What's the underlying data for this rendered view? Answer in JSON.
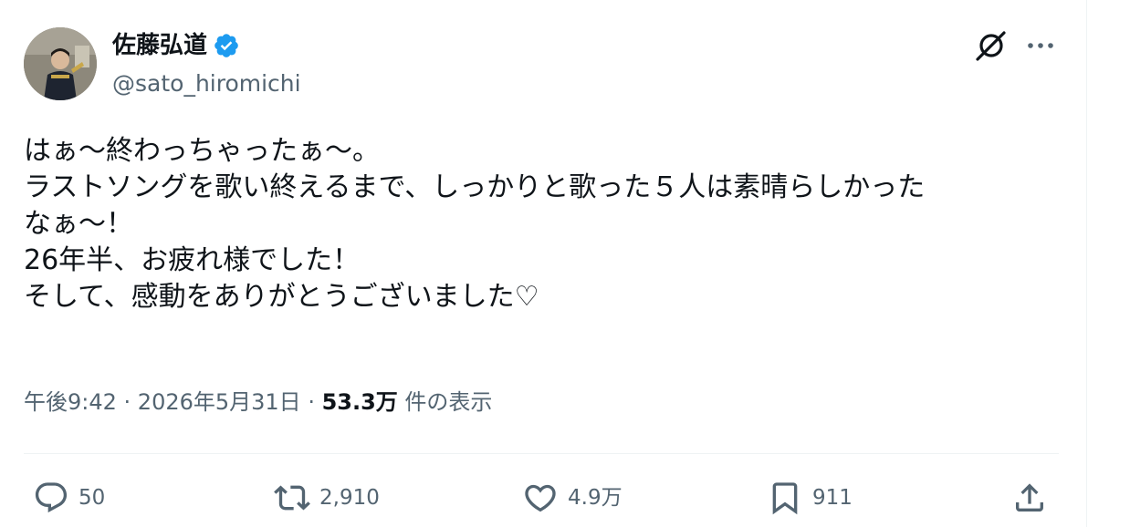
{
  "author": {
    "display_name": "佐藤弘道",
    "handle": "@sato_hiromichi",
    "verified": true,
    "verified_color": "#1d9bf0"
  },
  "body": {
    "lines": [
      "はぁ～終わっちゃったぁ～。",
      "ラストソングを歌い終えるまで、しっかりと歌った５人は素晴らしかった",
      "なぁ～！",
      "26年半、お疲れ様でした！",
      "そして、感動をありがとうございました♡"
    ]
  },
  "meta": {
    "time": "午後9:42",
    "separator1": " · ",
    "date": "2026年5月31日",
    "separator2": " · ",
    "views_count": "53.3万",
    "views_label": " 件の表示"
  },
  "actions": {
    "reply": {
      "icon": "reply-icon",
      "count": "50"
    },
    "retweet": {
      "icon": "retweet-icon",
      "count": "2,910"
    },
    "like": {
      "icon": "heart-icon",
      "count": "4.9万"
    },
    "bookmark": {
      "icon": "bookmark-icon",
      "count": "911"
    },
    "share": {
      "icon": "share-icon"
    }
  },
  "header_icons": {
    "grok": "grok-icon",
    "more": "more-icon"
  },
  "colors": {
    "text_primary": "#0f1419",
    "text_secondary": "#536471",
    "divider": "#eff3f4",
    "accent": "#1d9bf0"
  }
}
